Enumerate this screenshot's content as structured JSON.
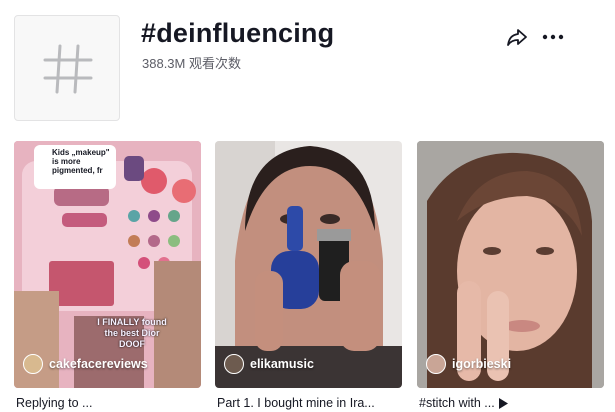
{
  "header": {
    "title": "#deinfluencing",
    "views": "388.3M 观看次数"
  },
  "videos": [
    {
      "author": "cakefacereviews",
      "caption": "Replying to ...",
      "overlay": "I FINALLY found the best Dior DOOF",
      "bubble": "Kids „makeup\" is more pigmented, fr"
    },
    {
      "author": "elikamusic",
      "caption": "Part 1. I bought mine in Ira..."
    },
    {
      "author": "igorbieski",
      "caption": "#stitch with ..."
    }
  ]
}
